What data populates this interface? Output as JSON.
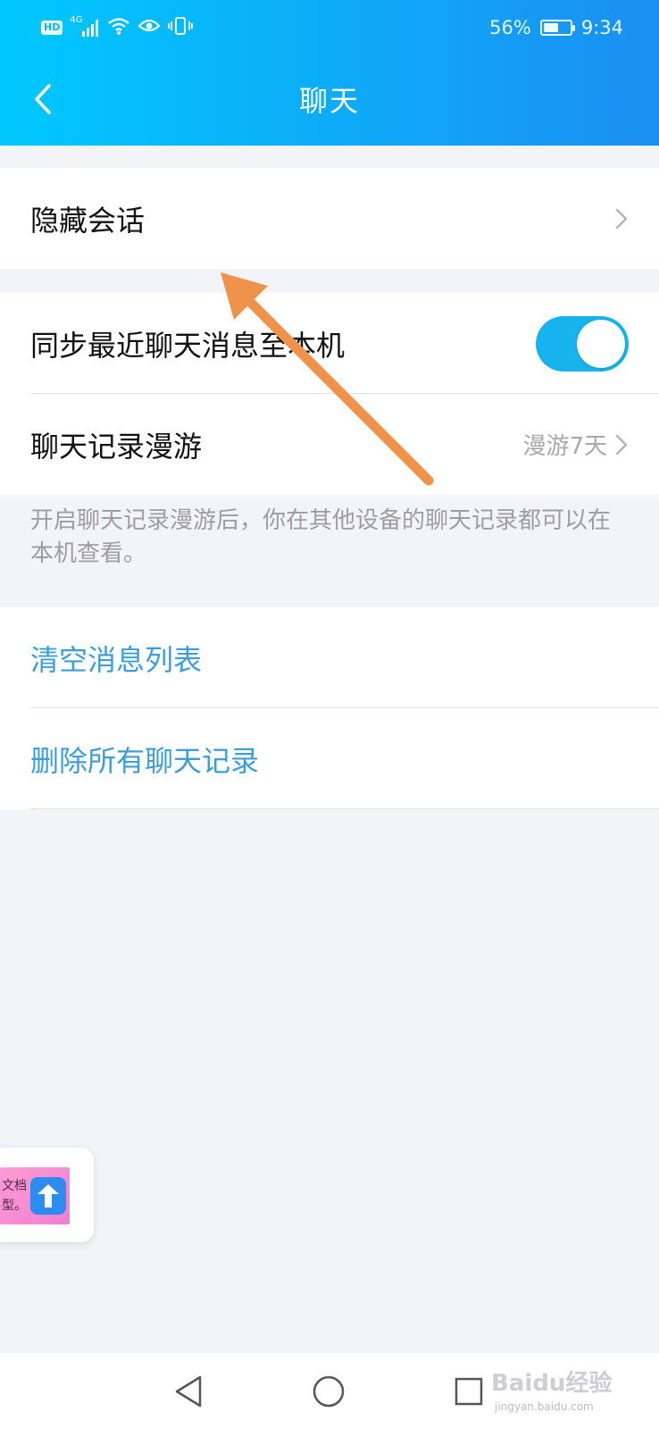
{
  "status_bar": {
    "hd": "HD",
    "network": "4G",
    "battery_percent": "56%",
    "time": "9:34",
    "battery_level": 0.56,
    "icons": [
      "signal-icon",
      "wifi-icon",
      "eye-icon",
      "vibrate-icon",
      "battery-icon"
    ]
  },
  "header": {
    "title": "聊天",
    "back_icon": "chevron-left-icon"
  },
  "sections": {
    "hidden": {
      "label": "隐藏会话"
    },
    "sync": {
      "sync_label": "同步最近聊天消息至本机",
      "sync_enabled": true,
      "roam_label": "聊天记录漫游",
      "roam_value": "漫游7天"
    },
    "note": "开启聊天记录漫游后，你在其他设备的聊天记录都可以在本机查看。",
    "actions": {
      "clear_label": "清空消息列表",
      "delete_label": "删除所有聊天记录"
    }
  },
  "floating_card": {
    "line1": "文档",
    "line2": "型。"
  },
  "navbar": {
    "icons": [
      "nav-back-icon",
      "nav-home-icon",
      "nav-recents-icon"
    ]
  },
  "watermark": {
    "text": "Baidu经验",
    "sub": "jingyan.baidu.com"
  },
  "colors": {
    "header_start": "#00c8ff",
    "header_end": "#1a8ff3",
    "toggle_on": "#17b3ef",
    "action_blue": "#3d9ddb",
    "annotation_arrow": "#f0934a",
    "background": "#f3f4f8"
  }
}
